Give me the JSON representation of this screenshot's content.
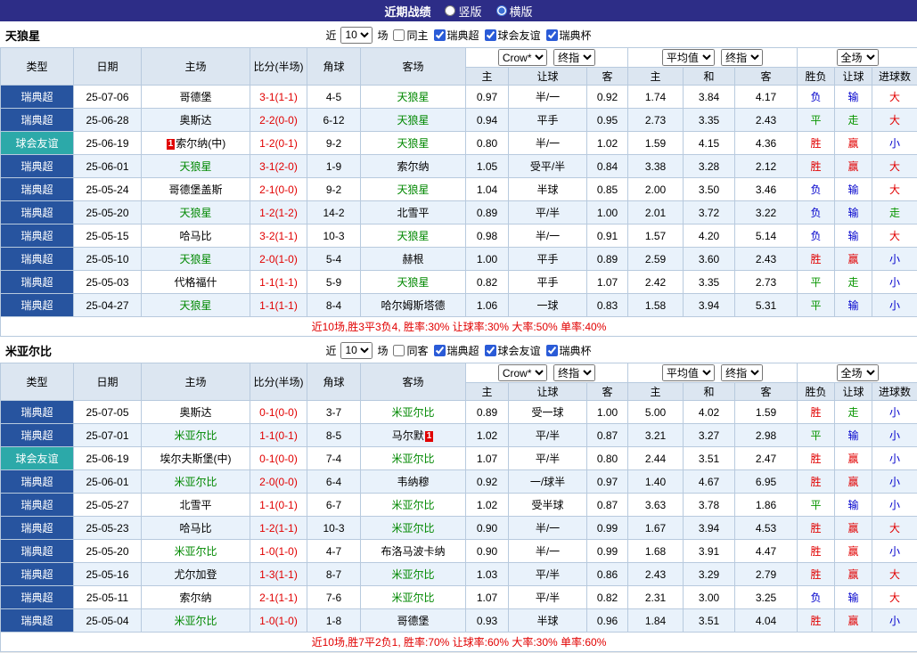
{
  "topbar": {
    "title": "近期战绩",
    "radio1_label": "竖版",
    "radio1_checked": false,
    "radio2_label": "横版",
    "radio2_checked": true
  },
  "controls": {
    "near": "近",
    "count": "10",
    "games": "场",
    "bookmaker": "Crow*",
    "final1": "终指",
    "average": "平均值",
    "final2": "终指",
    "scope": "全场"
  },
  "headers": {
    "main": [
      "类型",
      "日期",
      "主场",
      "比分(半场)",
      "角球",
      "客场"
    ],
    "sub": [
      "主",
      "让球",
      "客",
      "主",
      "和",
      "客",
      "胜负",
      "让球",
      "进球数"
    ]
  },
  "colors": {
    "topbar_bg": "#2d2d87",
    "league_bg": "#27549f",
    "friendly_bg": "#2ca9a9",
    "header_bg": "#dce6f1",
    "row_alt_bg": "#e9f2fb",
    "focus_team_green": "#008800",
    "win_red": "#e10000",
    "lose_blue": "#0000cc",
    "draw_green": "#089600"
  },
  "sections": [
    {
      "team": "天狼星",
      "same_filter": "同主",
      "same_checked": false,
      "league_filters": [
        "瑞典超",
        "球会友谊",
        "瑞典杯"
      ],
      "league_checked": [
        true,
        true,
        true
      ],
      "summary": "近10场,胜3平3负4, 胜率:30% 让球率:30% 大率:50% 单率:40%",
      "rows": [
        {
          "lg": "瑞典超",
          "lgType": "super",
          "date": "25-07-06",
          "home": "哥德堡",
          "hF": false,
          "hB": "",
          "score": "3-1(1-1)",
          "corner": "4-5",
          "away": "天狼星",
          "aF": true,
          "aB": "",
          "ah": "0.97",
          "hc": "半/一",
          "aa": "0.92",
          "eh": "1.74",
          "ed": "3.84",
          "ea": "4.17",
          "r1": "负",
          "c1": "blue",
          "r2": "输",
          "c2": "blue",
          "r3": "大",
          "c3": "red"
        },
        {
          "lg": "瑞典超",
          "lgType": "super",
          "date": "25-06-28",
          "home": "奥斯达",
          "hF": false,
          "hB": "",
          "score": "2-2(0-0)",
          "corner": "6-12",
          "away": "天狼星",
          "aF": true,
          "aB": "",
          "ah": "0.94",
          "hc": "平手",
          "aa": "0.95",
          "eh": "2.73",
          "ed": "3.35",
          "ea": "2.43",
          "r1": "平",
          "c1": "green",
          "r2": "走",
          "c2": "green",
          "r3": "大",
          "c3": "red"
        },
        {
          "lg": "球会友谊",
          "lgType": "friendly",
          "date": "25-06-19",
          "home": "索尔纳(中)",
          "hF": false,
          "hB": "1",
          "score": "1-2(0-1)",
          "corner": "9-2",
          "away": "天狼星",
          "aF": true,
          "aB": "",
          "ah": "0.80",
          "hc": "半/一",
          "aa": "1.02",
          "eh": "1.59",
          "ed": "4.15",
          "ea": "4.36",
          "r1": "胜",
          "c1": "red",
          "r2": "赢",
          "c2": "red",
          "r3": "小",
          "c3": "blue"
        },
        {
          "lg": "瑞典超",
          "lgType": "super",
          "date": "25-06-01",
          "home": "天狼星",
          "hF": true,
          "hB": "",
          "score": "3-1(2-0)",
          "corner": "1-9",
          "away": "索尔纳",
          "aF": false,
          "aB": "",
          "ah": "1.05",
          "hc": "受平/半",
          "aa": "0.84",
          "eh": "3.38",
          "ed": "3.28",
          "ea": "2.12",
          "r1": "胜",
          "c1": "red",
          "r2": "赢",
          "c2": "red",
          "r3": "大",
          "c3": "red"
        },
        {
          "lg": "瑞典超",
          "lgType": "super",
          "date": "25-05-24",
          "home": "哥德堡盖斯",
          "hF": false,
          "hB": "",
          "score": "2-1(0-0)",
          "corner": "9-2",
          "away": "天狼星",
          "aF": true,
          "aB": "",
          "ah": "1.04",
          "hc": "半球",
          "aa": "0.85",
          "eh": "2.00",
          "ed": "3.50",
          "ea": "3.46",
          "r1": "负",
          "c1": "blue",
          "r2": "输",
          "c2": "blue",
          "r3": "大",
          "c3": "red"
        },
        {
          "lg": "瑞典超",
          "lgType": "super",
          "date": "25-05-20",
          "home": "天狼星",
          "hF": true,
          "hB": "",
          "score": "1-2(1-2)",
          "corner": "14-2",
          "away": "北雪平",
          "aF": false,
          "aB": "",
          "ah": "0.89",
          "hc": "平/半",
          "aa": "1.00",
          "eh": "2.01",
          "ed": "3.72",
          "ea": "3.22",
          "r1": "负",
          "c1": "blue",
          "r2": "输",
          "c2": "blue",
          "r3": "走",
          "c3": "green"
        },
        {
          "lg": "瑞典超",
          "lgType": "super",
          "date": "25-05-15",
          "home": "哈马比",
          "hF": false,
          "hB": "",
          "score": "3-2(1-1)",
          "corner": "10-3",
          "away": "天狼星",
          "aF": true,
          "aB": "",
          "ah": "0.98",
          "hc": "半/一",
          "aa": "0.91",
          "eh": "1.57",
          "ed": "4.20",
          "ea": "5.14",
          "r1": "负",
          "c1": "blue",
          "r2": "输",
          "c2": "blue",
          "r3": "大",
          "c3": "red"
        },
        {
          "lg": "瑞典超",
          "lgType": "super",
          "date": "25-05-10",
          "home": "天狼星",
          "hF": true,
          "hB": "",
          "score": "2-0(1-0)",
          "corner": "5-4",
          "away": "赫根",
          "aF": false,
          "aB": "",
          "ah": "1.00",
          "hc": "平手",
          "aa": "0.89",
          "eh": "2.59",
          "ed": "3.60",
          "ea": "2.43",
          "r1": "胜",
          "c1": "red",
          "r2": "赢",
          "c2": "red",
          "r3": "小",
          "c3": "blue"
        },
        {
          "lg": "瑞典超",
          "lgType": "super",
          "date": "25-05-03",
          "home": "代格福什",
          "hF": false,
          "hB": "",
          "score": "1-1(1-1)",
          "corner": "5-9",
          "away": "天狼星",
          "aF": true,
          "aB": "",
          "ah": "0.82",
          "hc": "平手",
          "aa": "1.07",
          "eh": "2.42",
          "ed": "3.35",
          "ea": "2.73",
          "r1": "平",
          "c1": "green",
          "r2": "走",
          "c2": "green",
          "r3": "小",
          "c3": "blue"
        },
        {
          "lg": "瑞典超",
          "lgType": "super",
          "date": "25-04-27",
          "home": "天狼星",
          "hF": true,
          "hB": "",
          "score": "1-1(1-1)",
          "corner": "8-4",
          "away": "哈尔姆斯塔德",
          "aF": false,
          "aB": "",
          "ah": "1.06",
          "hc": "一球",
          "aa": "0.83",
          "eh": "1.58",
          "ed": "3.94",
          "ea": "5.31",
          "r1": "平",
          "c1": "green",
          "r2": "输",
          "c2": "blue",
          "r3": "小",
          "c3": "blue"
        }
      ]
    },
    {
      "team": "米亚尔比",
      "same_filter": "同客",
      "same_checked": false,
      "league_filters": [
        "瑞典超",
        "球会友谊",
        "瑞典杯"
      ],
      "league_checked": [
        true,
        true,
        true
      ],
      "summary": "近10场,胜7平2负1, 胜率:70% 让球率:60% 大率:30% 单率:60%",
      "rows": [
        {
          "lg": "瑞典超",
          "lgType": "super",
          "date": "25-07-05",
          "home": "奥斯达",
          "hF": false,
          "hB": "",
          "score": "0-1(0-0)",
          "corner": "3-7",
          "away": "米亚尔比",
          "aF": true,
          "aB": "",
          "ah": "0.89",
          "hc": "受一球",
          "aa": "1.00",
          "eh": "5.00",
          "ed": "4.02",
          "ea": "1.59",
          "r1": "胜",
          "c1": "red",
          "r2": "走",
          "c2": "green",
          "r3": "小",
          "c3": "blue"
        },
        {
          "lg": "瑞典超",
          "lgType": "super",
          "date": "25-07-01",
          "home": "米亚尔比",
          "hF": true,
          "hB": "",
          "score": "1-1(0-1)",
          "corner": "8-5",
          "away": "马尔默",
          "aF": false,
          "aB": "1",
          "ah": "1.02",
          "hc": "平/半",
          "aa": "0.87",
          "eh": "3.21",
          "ed": "3.27",
          "ea": "2.98",
          "r1": "平",
          "c1": "green",
          "r2": "输",
          "c2": "blue",
          "r3": "小",
          "c3": "blue"
        },
        {
          "lg": "球会友谊",
          "lgType": "friendly",
          "date": "25-06-19",
          "home": "埃尔夫斯堡(中)",
          "hF": false,
          "hB": "",
          "score": "0-1(0-0)",
          "corner": "7-4",
          "away": "米亚尔比",
          "aF": true,
          "aB": "",
          "ah": "1.07",
          "hc": "平/半",
          "aa": "0.80",
          "eh": "2.44",
          "ed": "3.51",
          "ea": "2.47",
          "r1": "胜",
          "c1": "red",
          "r2": "赢",
          "c2": "red",
          "r3": "小",
          "c3": "blue"
        },
        {
          "lg": "瑞典超",
          "lgType": "super",
          "date": "25-06-01",
          "home": "米亚尔比",
          "hF": true,
          "hB": "",
          "score": "2-0(0-0)",
          "corner": "6-4",
          "away": "韦纳穆",
          "aF": false,
          "aB": "",
          "ah": "0.92",
          "hc": "一/球半",
          "aa": "0.97",
          "eh": "1.40",
          "ed": "4.67",
          "ea": "6.95",
          "r1": "胜",
          "c1": "red",
          "r2": "赢",
          "c2": "red",
          "r3": "小",
          "c3": "blue"
        },
        {
          "lg": "瑞典超",
          "lgType": "super",
          "date": "25-05-27",
          "home": "北雪平",
          "hF": false,
          "hB": "",
          "score": "1-1(0-1)",
          "corner": "6-7",
          "away": "米亚尔比",
          "aF": true,
          "aB": "",
          "ah": "1.02",
          "hc": "受半球",
          "aa": "0.87",
          "eh": "3.63",
          "ed": "3.78",
          "ea": "1.86",
          "r1": "平",
          "c1": "green",
          "r2": "输",
          "c2": "blue",
          "r3": "小",
          "c3": "blue"
        },
        {
          "lg": "瑞典超",
          "lgType": "super",
          "date": "25-05-23",
          "home": "哈马比",
          "hF": false,
          "hB": "",
          "score": "1-2(1-1)",
          "corner": "10-3",
          "away": "米亚尔比",
          "aF": true,
          "aB": "",
          "ah": "0.90",
          "hc": "半/一",
          "aa": "0.99",
          "eh": "1.67",
          "ed": "3.94",
          "ea": "4.53",
          "r1": "胜",
          "c1": "red",
          "r2": "赢",
          "c2": "red",
          "r3": "大",
          "c3": "red"
        },
        {
          "lg": "瑞典超",
          "lgType": "super",
          "date": "25-05-20",
          "home": "米亚尔比",
          "hF": true,
          "hB": "",
          "score": "1-0(1-0)",
          "corner": "4-7",
          "away": "布洛马波卡纳",
          "aF": false,
          "aB": "",
          "ah": "0.90",
          "hc": "半/一",
          "aa": "0.99",
          "eh": "1.68",
          "ed": "3.91",
          "ea": "4.47",
          "r1": "胜",
          "c1": "red",
          "r2": "赢",
          "c2": "red",
          "r3": "小",
          "c3": "blue"
        },
        {
          "lg": "瑞典超",
          "lgType": "super",
          "date": "25-05-16",
          "home": "尤尔加登",
          "hF": false,
          "hB": "",
          "score": "1-3(1-1)",
          "corner": "8-7",
          "away": "米亚尔比",
          "aF": true,
          "aB": "",
          "ah": "1.03",
          "hc": "平/半",
          "aa": "0.86",
          "eh": "2.43",
          "ed": "3.29",
          "ea": "2.79",
          "r1": "胜",
          "c1": "red",
          "r2": "赢",
          "c2": "red",
          "r3": "大",
          "c3": "red"
        },
        {
          "lg": "瑞典超",
          "lgType": "super",
          "date": "25-05-11",
          "home": "索尔纳",
          "hF": false,
          "hB": "",
          "score": "2-1(1-1)",
          "corner": "7-6",
          "away": "米亚尔比",
          "aF": true,
          "aB": "",
          "ah": "1.07",
          "hc": "平/半",
          "aa": "0.82",
          "eh": "2.31",
          "ed": "3.00",
          "ea": "3.25",
          "r1": "负",
          "c1": "blue",
          "r2": "输",
          "c2": "blue",
          "r3": "大",
          "c3": "red"
        },
        {
          "lg": "瑞典超",
          "lgType": "super",
          "date": "25-05-04",
          "home": "米亚尔比",
          "hF": true,
          "hB": "",
          "score": "1-0(1-0)",
          "corner": "1-8",
          "away": "哥德堡",
          "aF": false,
          "aB": "",
          "ah": "0.93",
          "hc": "半球",
          "aa": "0.96",
          "eh": "1.84",
          "ed": "3.51",
          "ea": "4.04",
          "r1": "胜",
          "c1": "red",
          "r2": "赢",
          "c2": "red",
          "r3": "小",
          "c3": "blue"
        }
      ]
    }
  ]
}
